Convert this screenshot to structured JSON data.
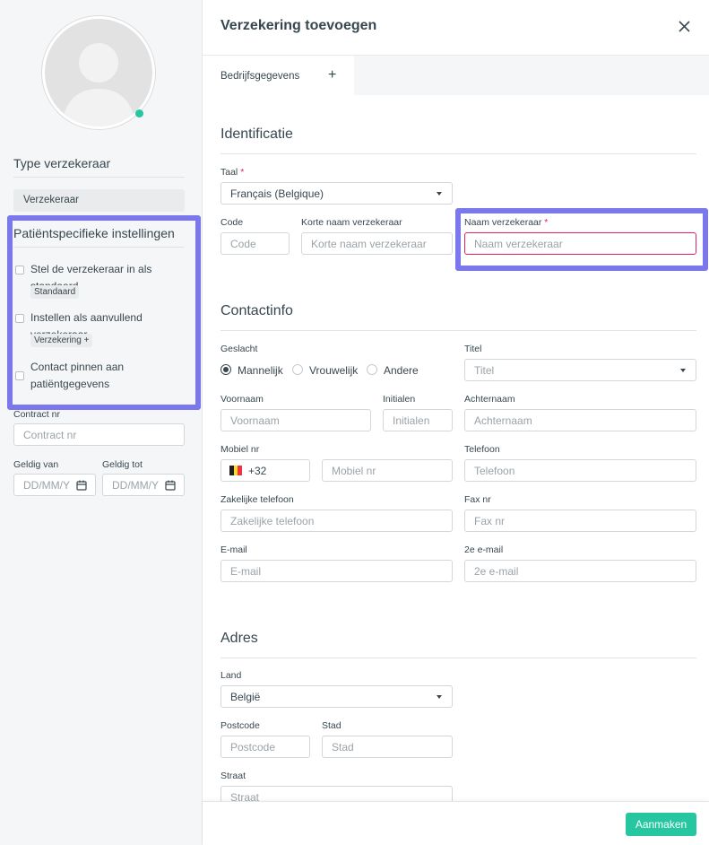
{
  "sidebar": {
    "type_title": "Type verzekeraar",
    "type_value": "Verzekeraar",
    "patient_title": "Patiëntspecifieke instellingen",
    "options": [
      {
        "label": "Stel de verzekeraar in als standaard",
        "chip": "Standaard"
      },
      {
        "label": "Instellen als aanvullend verzekeraar",
        "chip": "Verzekering +"
      },
      {
        "label": "Contact pinnen aan patiëntgegevens",
        "chip": ""
      }
    ],
    "contract_label": "Contract nr",
    "contract_placeholder": "Contract nr",
    "valid_from_label": "Geldig van",
    "valid_from_placeholder": "DD/MM/Y",
    "valid_to_label": "Geldig tot",
    "valid_to_placeholder": "DD/MM/Y"
  },
  "dialog": {
    "title": "Verzekering toevoegen",
    "tabs": [
      {
        "label": "Bedrijfsgegevens"
      }
    ],
    "add_tab": "+",
    "submit": "Aanmaken"
  },
  "identification": {
    "title": "Identificatie",
    "language_label": "Taal",
    "language_value": "Français (Belgique)",
    "code_label": "Code",
    "code_placeholder": "Code",
    "short_name_label": "Korte naam verzekeraar",
    "short_name_placeholder": "Korte naam verzekeraar",
    "name_label": "Naam verzekeraar",
    "name_placeholder": "Naam verzekeraar",
    "required_mark": "*"
  },
  "contact": {
    "title": "Contactinfo",
    "gender_label": "Geslacht",
    "genders": [
      "Mannelijk",
      "Vrouwelijk",
      "Andere"
    ],
    "gender_selected": "Mannelijk",
    "title_label": "Titel",
    "title_placeholder": "Titel",
    "first_name_label": "Voornaam",
    "first_name_placeholder": "Voornaam",
    "initials_label": "Initialen",
    "initials_placeholder": "Initialen",
    "last_name_label": "Achternaam",
    "last_name_placeholder": "Achternaam",
    "mobile_label": "Mobiel nr",
    "mobile_prefix": "+32",
    "mobile_placeholder": "Mobiel nr",
    "phone_label": "Telefoon",
    "phone_placeholder": "Telefoon",
    "work_phone_label": "Zakelijke telefoon",
    "work_phone_placeholder": "Zakelijke telefoon",
    "fax_label": "Fax nr",
    "fax_placeholder": "Fax nr",
    "email_label": "E-mail",
    "email_placeholder": "E-mail",
    "email2_label": "2e e-mail",
    "email2_placeholder": "2e e-mail"
  },
  "address": {
    "title": "Adres",
    "country_label": "Land",
    "country_value": "België",
    "postcode_label": "Postcode",
    "postcode_placeholder": "Postcode",
    "city_label": "Stad",
    "city_placeholder": "Stad",
    "street_label": "Straat",
    "street_placeholder": "Straat"
  },
  "colors": {
    "accent": "#26c6a1",
    "highlight": "#7b77ec",
    "required": "#e2245c"
  }
}
